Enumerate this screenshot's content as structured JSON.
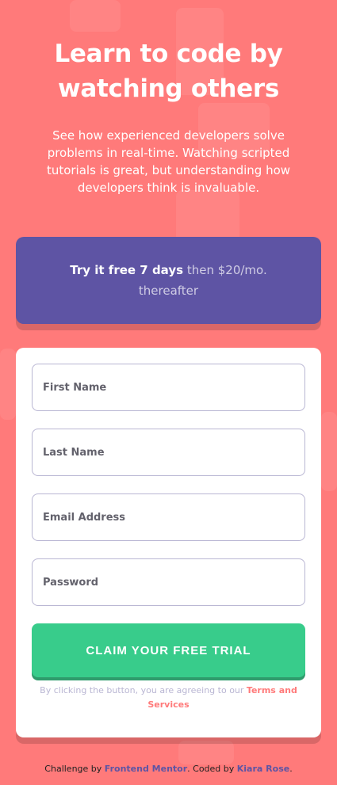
{
  "hero": {
    "title": "Learn to code by watching others",
    "description": "See how experienced developers solve problems in real-time. Watching scripted tutorials is great, but understanding how developers think is invaluable."
  },
  "promo": {
    "highlight": "Try it free 7 days",
    "rest": "then $20/mo. thereafter"
  },
  "form": {
    "first_name_placeholder": "First Name",
    "last_name_placeholder": "Last Name",
    "email_placeholder": "Email Address",
    "password_placeholder": "Password",
    "submit_label": "CLAIM YOUR FREE TRIAL",
    "terms_prefix": "By clicking the button, you are agreeing to our",
    "terms_link": "Terms and Services"
  },
  "footer": {
    "prefix": "Challenge by",
    "challenge_link": "Frontend Mentor",
    "middle": ". Coded by",
    "author_link": "Kiara Rose",
    "suffix": "."
  },
  "colors": {
    "background": "#ff7a7a",
    "promo": "#5e54a4",
    "button": "#38cc8b",
    "border": "#b9b6d3"
  }
}
